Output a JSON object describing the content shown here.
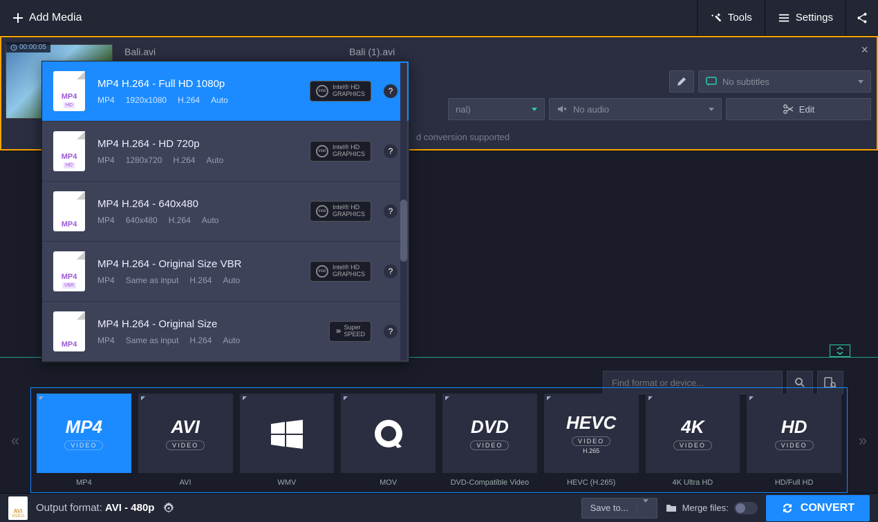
{
  "topbar": {
    "add_media": "Add Media",
    "tools": "Tools",
    "settings": "Settings"
  },
  "file": {
    "timestamp": "00:00:05",
    "name1": "Bali.avi",
    "name2": "Bali (1).avi",
    "subtitles": "No subtitles",
    "audio": "No audio",
    "edit": "Edit",
    "preset_selected": "nal)",
    "info_text": "d conversion supported"
  },
  "presets": [
    {
      "title": "MP4 H.264 - Full HD 1080p",
      "fmt": "MP4",
      "res": "1920x1080",
      "codec": "H.264",
      "rate": "Auto",
      "quality": "HD",
      "badge": "intel"
    },
    {
      "title": "MP4 H.264 - HD 720p",
      "fmt": "MP4",
      "res": "1280x720",
      "codec": "H.264",
      "rate": "Auto",
      "quality": "HD",
      "badge": "intel"
    },
    {
      "title": "MP4 H.264 - 640x480",
      "fmt": "MP4",
      "res": "640x480",
      "codec": "H.264",
      "rate": "Auto",
      "quality": "",
      "badge": "intel"
    },
    {
      "title": "MP4 H.264 - Original Size VBR",
      "fmt": "MP4",
      "res": "Same as input",
      "codec": "H.264",
      "rate": "Auto",
      "quality": "VBR",
      "badge": "intel"
    },
    {
      "title": "MP4 H.264 - Original Size",
      "fmt": "MP4",
      "res": "Same as input",
      "codec": "H.264",
      "rate": "Auto",
      "quality": "",
      "badge": "speed"
    }
  ],
  "badge_labels": {
    "intel_line1": "Intel® HD",
    "intel_line2": "GRAPHICS",
    "speed_line1": "Super",
    "speed_line2": "SPEED"
  },
  "search": {
    "placeholder": "Find format or device..."
  },
  "formats": [
    {
      "logo": "MP4",
      "sub": "VIDEO",
      "label": "MP4",
      "active": true
    },
    {
      "logo": "AVI",
      "sub": "VIDEO",
      "label": "AVI"
    },
    {
      "logo": "win",
      "sub": "",
      "label": "WMV"
    },
    {
      "logo": "Q",
      "sub": "",
      "label": "MOV"
    },
    {
      "logo": "DVD",
      "sub": "VIDEO",
      "label": "DVD-Compatible Video"
    },
    {
      "logo": "HEVC",
      "sub": "VIDEO",
      "note": "H.265",
      "label": "HEVC (H.265)"
    },
    {
      "logo": "4K",
      "sub": "VIDEO",
      "label": "4K Ultra HD"
    },
    {
      "logo": "HD",
      "sub": "VIDEO",
      "label": "HD/Full HD"
    }
  ],
  "bottom": {
    "output_label": "Output format: ",
    "output_value": "AVI - 480p",
    "save_to": "Save to...",
    "merge": "Merge files:",
    "convert": "CONVERT"
  }
}
